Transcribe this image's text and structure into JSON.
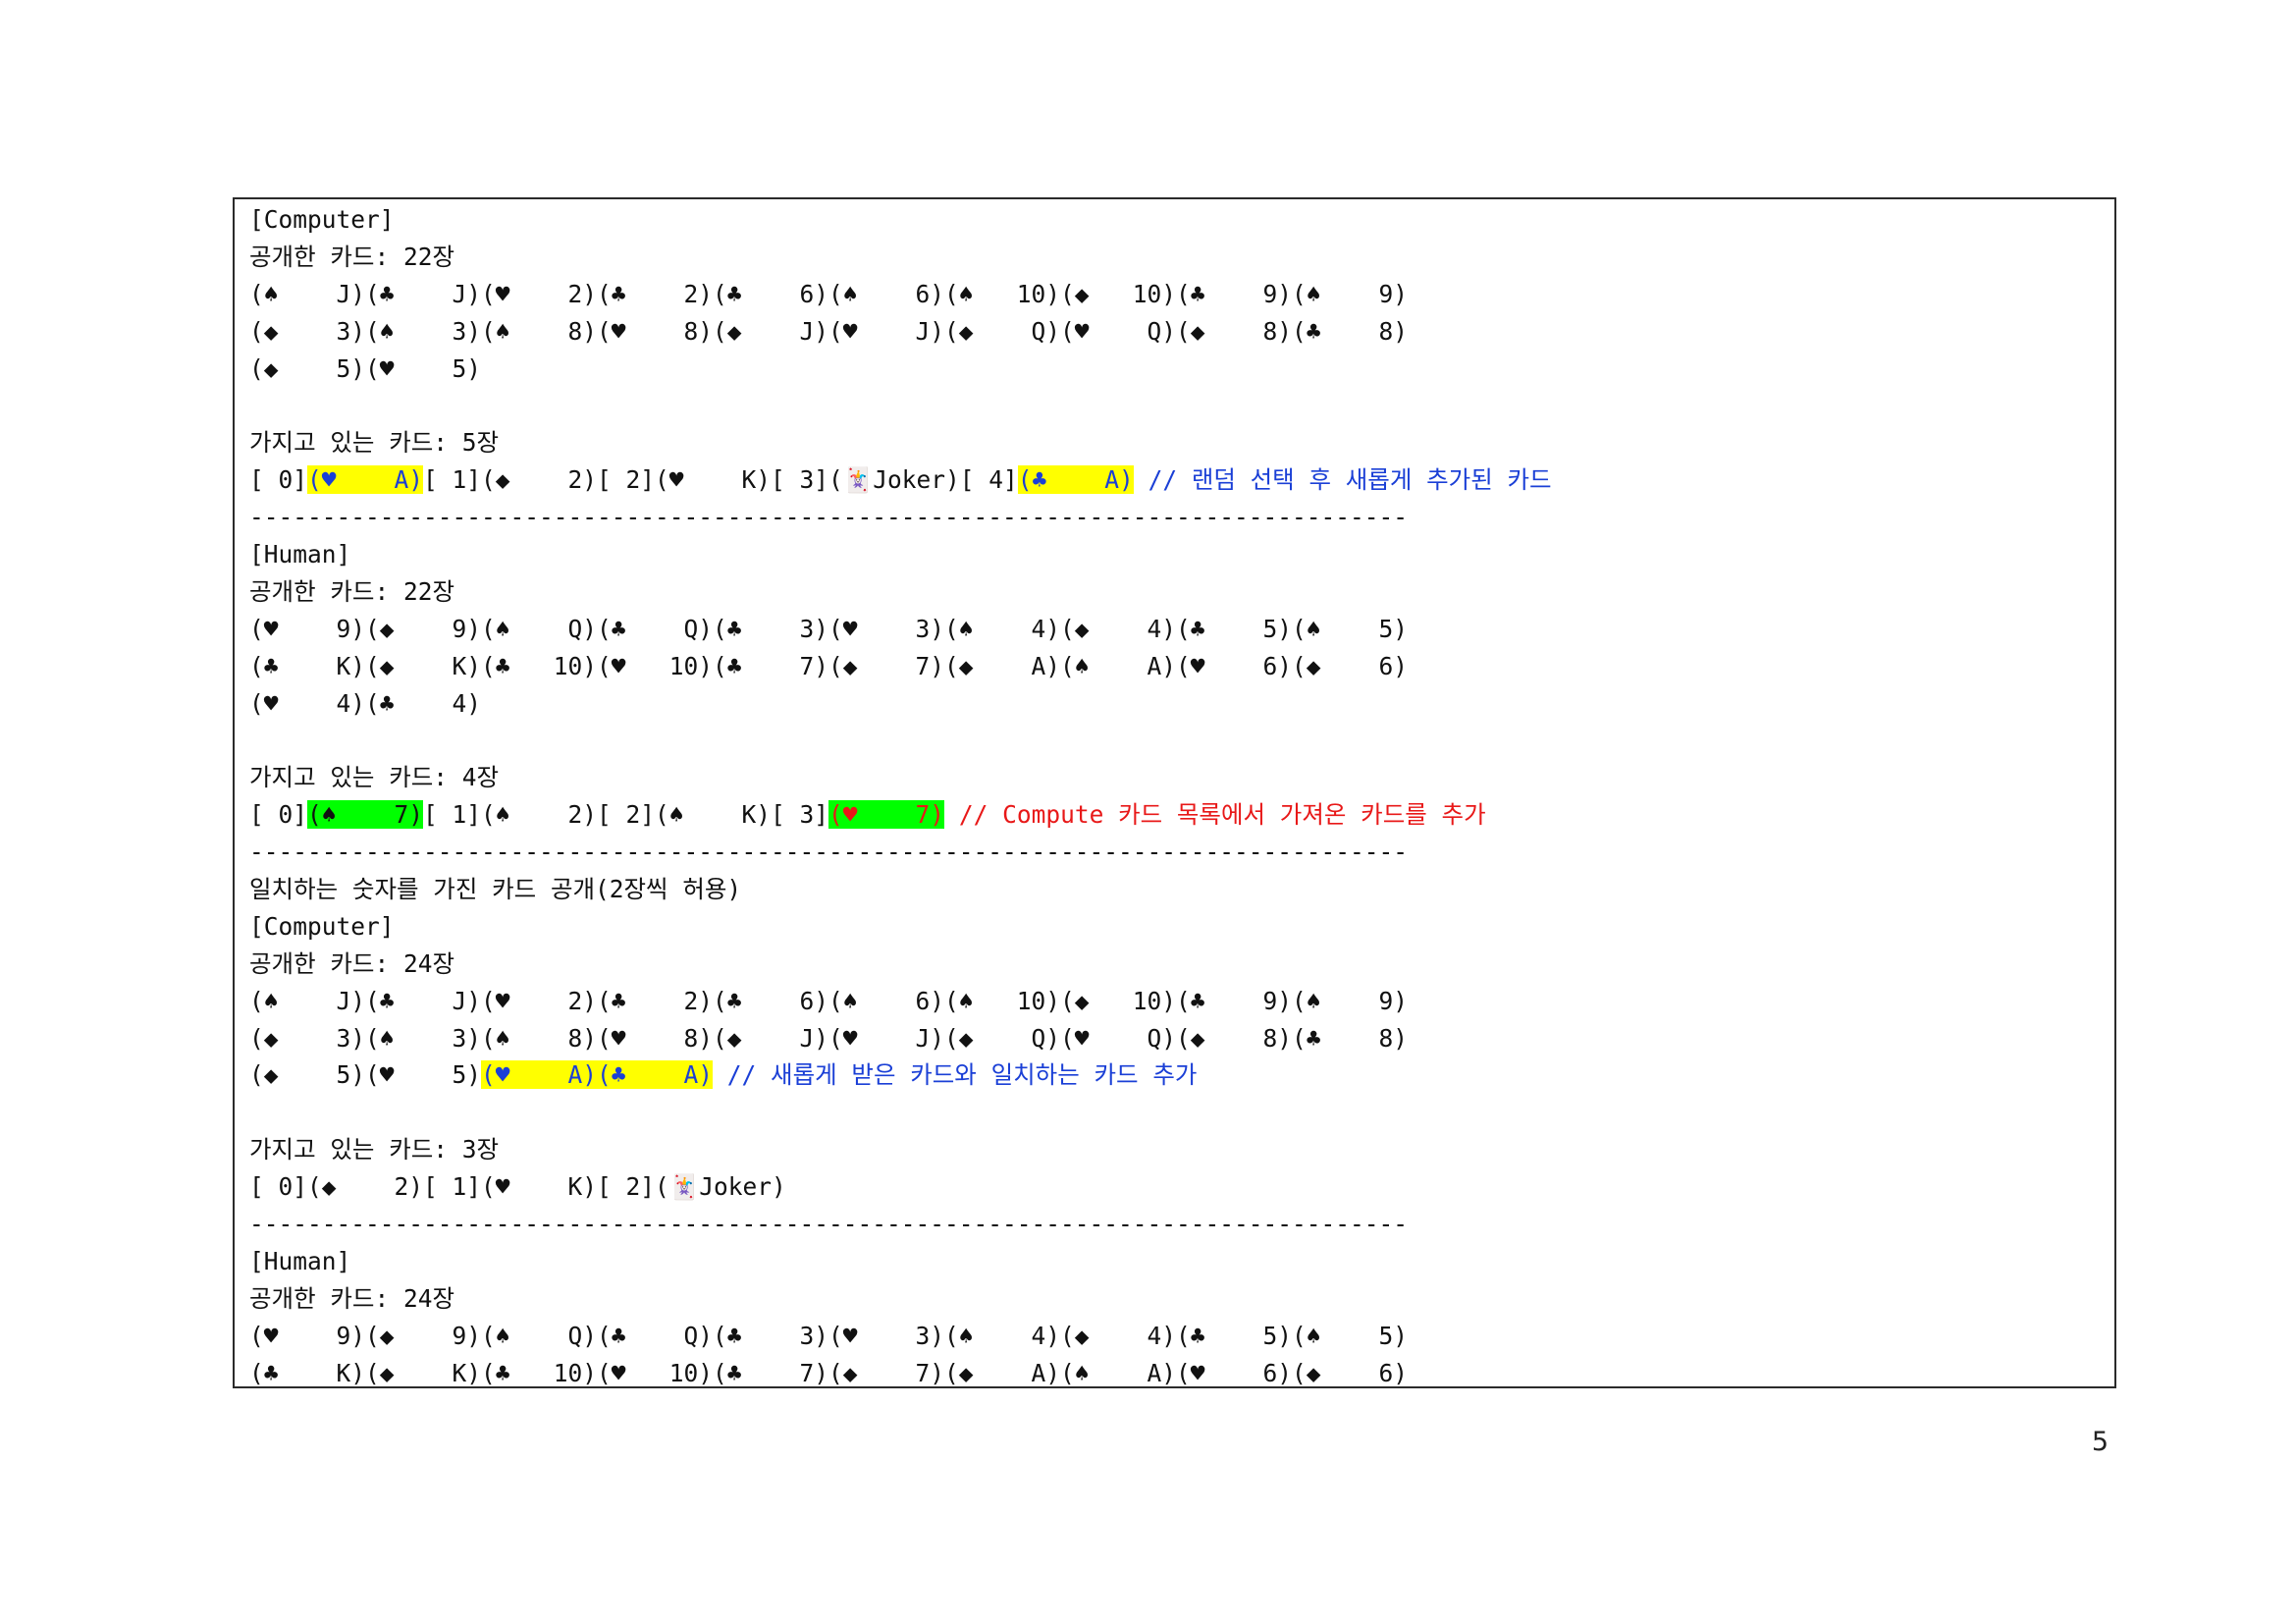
{
  "page_number": "5",
  "lines": [
    [
      {
        "t": "[Computer]"
      }
    ],
    [
      {
        "t": "공개한 카드: 22장"
      }
    ],
    [
      {
        "t": "(♠    J)(♣    J)(♥    2)(♣    2)(♣    6)(♠    6)(♠   10)(◆   10)(♣    9)(♠    9)"
      }
    ],
    [
      {
        "t": "(◆    3)(♠    3)(♠    8)(♥    8)(◆    J)(♥    J)(◆    Q)(♥    Q)(◆    8)(♣    8)"
      }
    ],
    [
      {
        "t": "(◆    5)(♥    5)"
      }
    ],
    [
      {
        "t": ""
      }
    ],
    [
      {
        "t": "가지고 있는 카드: 5장"
      }
    ],
    [
      {
        "t": "[ 0]"
      },
      {
        "t": "(♥    A)",
        "hl": "yellow",
        "color": "blue"
      },
      {
        "t": "[ 1](◆    2)[ 2](♥    K)[ 3](🃏Joker)[ 4]"
      },
      {
        "t": "(♣    A)",
        "hl": "yellow",
        "color": "blue"
      },
      {
        "t": " // 랜덤 선택 후 새롭게 추가된 카드",
        "color": "blue"
      }
    ],
    [
      {
        "t": "--------------------------------------------------------------------------------"
      }
    ],
    [
      {
        "t": "[Human]"
      }
    ],
    [
      {
        "t": "공개한 카드: 22장"
      }
    ],
    [
      {
        "t": "(♥    9)(◆    9)(♠    Q)(♣    Q)(♣    3)(♥    3)(♠    4)(◆    4)(♣    5)(♠    5)"
      }
    ],
    [
      {
        "t": "(♣    K)(◆    K)(♣   10)(♥   10)(♣    7)(◆    7)(◆    A)(♠    A)(♥    6)(◆    6)"
      }
    ],
    [
      {
        "t": "(♥    4)(♣    4)"
      }
    ],
    [
      {
        "t": ""
      }
    ],
    [
      {
        "t": "가지고 있는 카드: 4장"
      }
    ],
    [
      {
        "t": "[ 0]"
      },
      {
        "t": "(♠    7)",
        "hl": "green"
      },
      {
        "t": "[ 1](♠    2)[ 2](♠    K)[ 3]"
      },
      {
        "t": "(♥    7)",
        "hl": "green",
        "color": "red"
      },
      {
        "t": " // Compute 카드 목록에서 가져온 카드를 추가",
        "color": "red"
      }
    ],
    [
      {
        "t": "--------------------------------------------------------------------------------"
      }
    ],
    [
      {
        "t": "일치하는 숫자를 가진 카드 공개(2장씩 허용)"
      }
    ],
    [
      {
        "t": "[Computer]"
      }
    ],
    [
      {
        "t": "공개한 카드: 24장"
      }
    ],
    [
      {
        "t": "(♠    J)(♣    J)(♥    2)(♣    2)(♣    6)(♠    6)(♠   10)(◆   10)(♣    9)(♠    9)"
      }
    ],
    [
      {
        "t": "(◆    3)(♠    3)(♠    8)(♥    8)(◆    J)(♥    J)(◆    Q)(♥    Q)(◆    8)(♣    8)"
      }
    ],
    [
      {
        "t": "(◆    5)(♥    5)"
      },
      {
        "t": "(♥    A)(♣    A)",
        "hl": "yellow",
        "color": "blue"
      },
      {
        "t": " // 새롭게 받은 카드와 일치하는 카드 추가",
        "color": "blue"
      }
    ],
    [
      {
        "t": ""
      }
    ],
    [
      {
        "t": "가지고 있는 카드: 3장"
      }
    ],
    [
      {
        "t": "[ 0](◆    2)[ 1](♥    K)[ 2](🃏Joker)"
      }
    ],
    [
      {
        "t": "--------------------------------------------------------------------------------"
      }
    ],
    [
      {
        "t": "[Human]"
      }
    ],
    [
      {
        "t": "공개한 카드: 24장"
      }
    ],
    [
      {
        "t": "(♥    9)(◆    9)(♠    Q)(♣    Q)(♣    3)(♥    3)(♠    4)(◆    4)(♣    5)(♠    5)"
      }
    ],
    [
      {
        "t": "(♣    K)(◆    K)(♣   10)(♥   10)(♣    7)(◆    7)(◆    A)(♠    A)(♥    6)(◆    6)"
      }
    ]
  ]
}
